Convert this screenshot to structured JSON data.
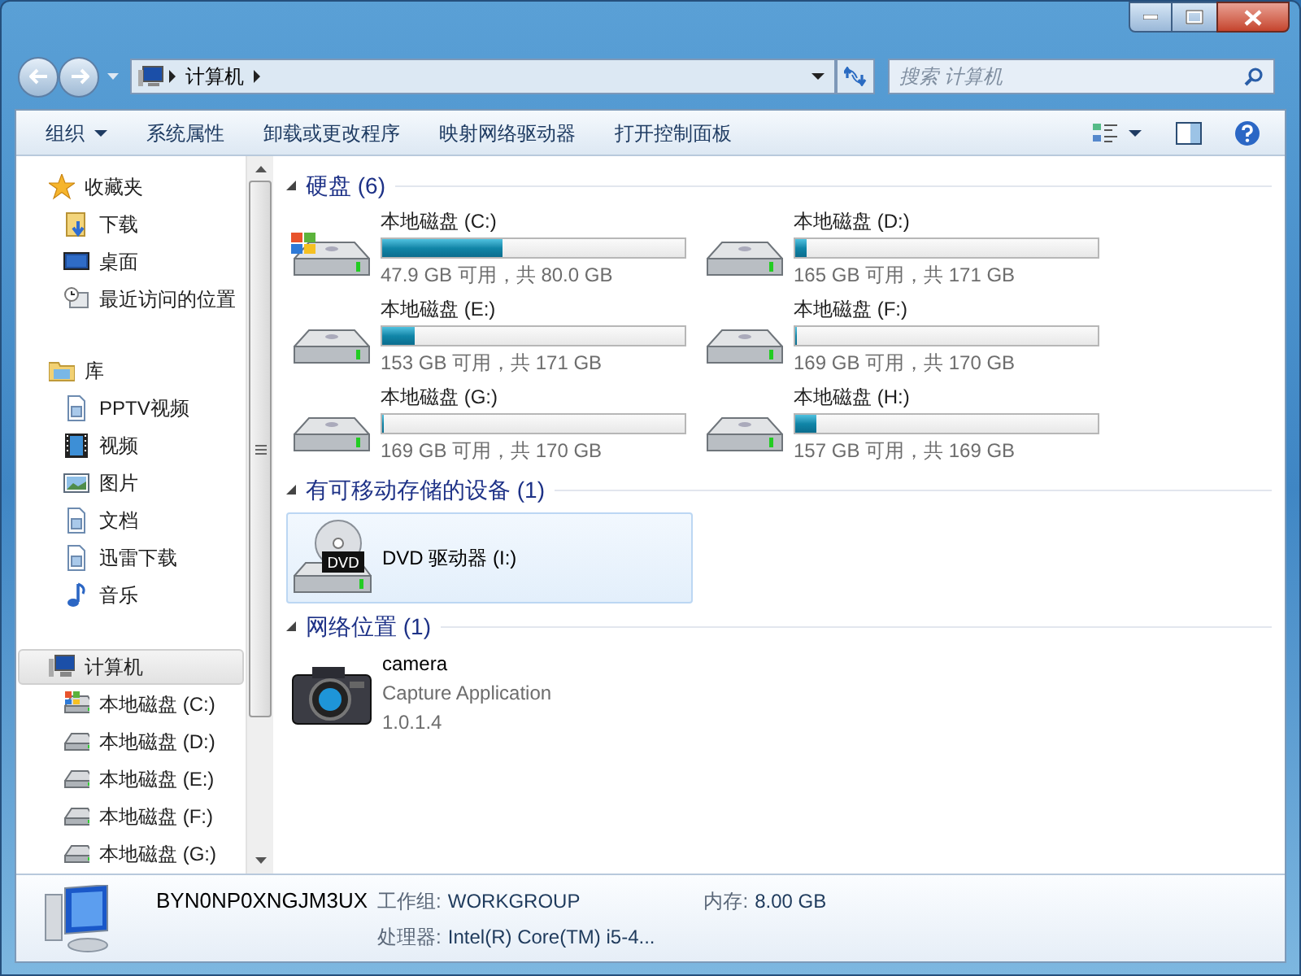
{
  "address": {
    "crumbs": [
      "计算机"
    ]
  },
  "search": {
    "placeholder": "搜索 计算机"
  },
  "toolbar": {
    "items": [
      {
        "label": "组织",
        "dropdown": true
      },
      {
        "label": "系统属性",
        "dropdown": false
      },
      {
        "label": "卸载或更改程序",
        "dropdown": false
      },
      {
        "label": "映射网络驱动器",
        "dropdown": false
      },
      {
        "label": "打开控制面板",
        "dropdown": false
      }
    ]
  },
  "nav": [
    {
      "label": "收藏夹",
      "kind": "star",
      "selected": false,
      "children": [
        {
          "label": "下载",
          "kind": "download",
          "selected": false
        },
        {
          "label": "桌面",
          "kind": "desktop",
          "selected": false
        },
        {
          "label": "最近访问的位置",
          "kind": "recent",
          "selected": false
        }
      ]
    },
    {
      "label": "库",
      "kind": "library",
      "selected": false,
      "children": [
        {
          "label": "PPTV视频",
          "kind": "document",
          "selected": false
        },
        {
          "label": "视频",
          "kind": "video",
          "selected": false
        },
        {
          "label": "图片",
          "kind": "picture",
          "selected": false
        },
        {
          "label": "文档",
          "kind": "document",
          "selected": false
        },
        {
          "label": "迅雷下载",
          "kind": "document",
          "selected": false
        },
        {
          "label": "音乐",
          "kind": "music",
          "selected": false
        }
      ]
    },
    {
      "label": "计算机",
      "kind": "computer",
      "selected": true,
      "children": [
        {
          "label": "本地磁盘 (C:)",
          "kind": "system",
          "selected": false
        },
        {
          "label": "本地磁盘 (D:)",
          "kind": "drive",
          "selected": false
        },
        {
          "label": "本地磁盘 (E:)",
          "kind": "drive",
          "selected": false
        },
        {
          "label": "本地磁盘 (F:)",
          "kind": "drive",
          "selected": false
        },
        {
          "label": "本地磁盘 (G:)",
          "kind": "drive",
          "selected": false
        }
      ]
    }
  ],
  "groups": [
    {
      "title": "硬盘 (6)",
      "kind": "drives",
      "items": [
        {
          "name": "本地磁盘 (C:)",
          "kind": "system",
          "level": 0.4,
          "info": "47.9 GB 可用，共 80.0 GB"
        },
        {
          "name": "本地磁盘 (D:)",
          "kind": "drive",
          "level": 0.035,
          "info": "165 GB 可用，共 171 GB"
        },
        {
          "name": "本地磁盘 (E:)",
          "kind": "drive",
          "level": 0.105,
          "info": "153 GB 可用，共 171 GB"
        },
        {
          "name": "本地磁盘 (F:)",
          "kind": "drive",
          "level": 0.006,
          "info": "169 GB 可用，共 170 GB"
        },
        {
          "name": "本地磁盘 (G:)",
          "kind": "drive",
          "level": 0.006,
          "info": "169 GB 可用，共 170 GB"
        },
        {
          "name": "本地磁盘 (H:)",
          "kind": "drive",
          "level": 0.071,
          "info": "157 GB 可用，共 169 GB"
        }
      ]
    },
    {
      "title": "有可移动存储的设备 (1)",
      "kind": "removable",
      "items": [
        {
          "name": "DVD 驱动器 (I:)",
          "kind": "dvd",
          "label": "DVD",
          "selected": true
        }
      ]
    },
    {
      "title": "网络位置 (1)",
      "kind": "network",
      "items": [
        {
          "name": "camera",
          "kind": "camera",
          "lines": [
            "Capture Application",
            "1.0.1.4"
          ]
        }
      ]
    }
  ],
  "details": {
    "computer_name": "BYN0NP0XNGJM3UX",
    "workgroup_label": "工作组:",
    "workgroup": "WORKGROUP",
    "memory_label": "内存:",
    "memory": "8.00 GB",
    "cpu_label": "处理器:",
    "cpu": "Intel(R) Core(TM) i5-4..."
  }
}
